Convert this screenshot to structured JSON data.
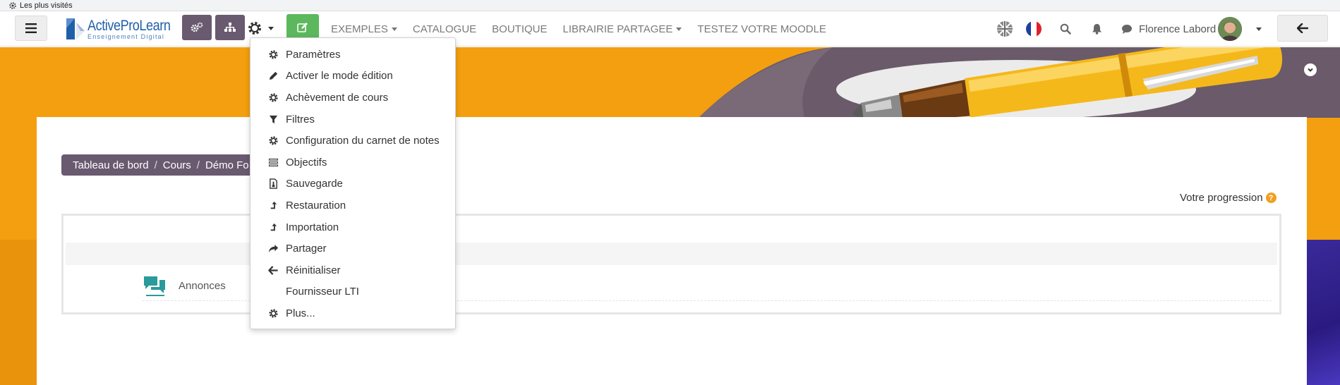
{
  "bookmarks_bar": {
    "item": "Les plus visités"
  },
  "navbar": {
    "logo": {
      "name": "ActiveProLearn",
      "tagline": "Enseignement Digital"
    },
    "menu": [
      {
        "label": "EXEMPLES",
        "dropdown": true
      },
      {
        "label": "CATALOGUE",
        "dropdown": false
      },
      {
        "label": "BOUTIQUE",
        "dropdown": false
      },
      {
        "label": "LIBRAIRIE PARTAGEE",
        "dropdown": true
      },
      {
        "label": "TESTEZ VOTRE MOODLE",
        "dropdown": false
      }
    ],
    "user_name": "Florence Labord",
    "colors": {
      "purple_button": "#695a70",
      "green_button": "#5cb85c"
    }
  },
  "breadcrumb": {
    "items": [
      "Tableau de bord",
      "Cours",
      "Démo Fo"
    ],
    "separator": "/"
  },
  "progress": {
    "label": "Votre progression",
    "help_glyph": "?"
  },
  "activity": {
    "label": "Annonces"
  },
  "dropdown": {
    "items": [
      {
        "label": "Paramètres",
        "icon": "gear-icon"
      },
      {
        "label": "Activer le mode édition",
        "icon": "pencil-icon"
      },
      {
        "label": "Achèvement de cours",
        "icon": "gear-icon"
      },
      {
        "label": "Filtres",
        "icon": "filter-icon"
      },
      {
        "label": "Configuration du carnet de notes",
        "icon": "gear-icon"
      },
      {
        "label": "Objectifs",
        "icon": "list-icon"
      },
      {
        "label": "Sauvegarde",
        "icon": "file-icon"
      },
      {
        "label": "Restauration",
        "icon": "level-up-icon"
      },
      {
        "label": "Importation",
        "icon": "level-up-icon"
      },
      {
        "label": "Partager",
        "icon": "share-icon"
      },
      {
        "label": "Réinitialiser",
        "icon": "arrow-left-icon"
      },
      {
        "label": "Fournisseur LTI",
        "icon": ""
      },
      {
        "label": "Plus...",
        "icon": "gear-icon"
      }
    ]
  },
  "banner_colors": {
    "orange": "#f49f0f",
    "dark": "#1f1748",
    "pen_body": "#f5b81a"
  }
}
